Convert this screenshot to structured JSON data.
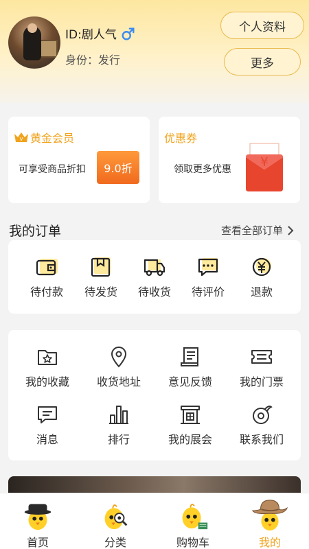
{
  "header": {
    "user_id": "ID:剧人气",
    "role": "身份：发行",
    "profile_button": "个人资料",
    "more_button": "更多"
  },
  "vip": {
    "title": "黄金会员",
    "desc": "可享受商品折扣",
    "discount": "9.0折"
  },
  "coupon": {
    "title": "优惠券",
    "desc": "领取更多优惠"
  },
  "orders": {
    "title": "我的订单",
    "view_all": "查看全部订单",
    "items": [
      {
        "label": "待付款",
        "icon": "wallet-icon"
      },
      {
        "label": "待发货",
        "icon": "package-icon"
      },
      {
        "label": "待收货",
        "icon": "truck-icon"
      },
      {
        "label": "待评价",
        "icon": "comment-icon"
      },
      {
        "label": "退款",
        "icon": "refund-icon"
      }
    ]
  },
  "services": {
    "items": [
      {
        "label": "我的收藏",
        "icon": "star-folder-icon"
      },
      {
        "label": "收货地址",
        "icon": "location-pin-icon"
      },
      {
        "label": "意见反馈",
        "icon": "feedback-scroll-icon"
      },
      {
        "label": "我的门票",
        "icon": "ticket-icon"
      },
      {
        "label": "消息",
        "icon": "message-icon"
      },
      {
        "label": "排行",
        "icon": "ranking-icon"
      },
      {
        "label": "我的展会",
        "icon": "exhibition-icon"
      },
      {
        "label": "联系我们",
        "icon": "contact-icon"
      }
    ]
  },
  "tabbar": {
    "items": [
      {
        "label": "首页",
        "icon": "chick-hat-icon"
      },
      {
        "label": "分类",
        "icon": "chick-magnifier-icon"
      },
      {
        "label": "购物车",
        "icon": "chick-cart-icon"
      },
      {
        "label": "我的",
        "icon": "chick-cowboy-icon"
      }
    ],
    "active": "我的"
  },
  "colors": {
    "accent": "#f0a31d",
    "coupon_red": "#e8452f",
    "header_bg": "#fde7a0"
  }
}
